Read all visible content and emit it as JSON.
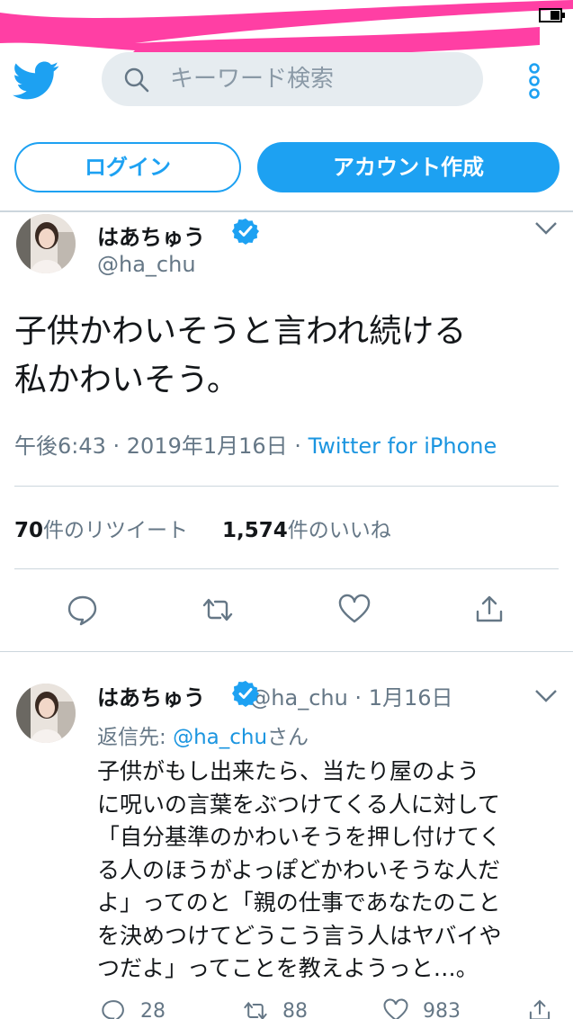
{
  "colors": {
    "accent": "#1da1f2",
    "link": "#1b95e0",
    "muted": "#657786",
    "scribble": "#ff3fa4"
  },
  "header": {
    "logo_icon": "twitter-bird-icon",
    "search": {
      "placeholder": "キーワード検索",
      "icon": "search-icon"
    },
    "more_icon": "more-vertical-icon"
  },
  "auth": {
    "login_label": "ログイン",
    "signup_label": "アカウント作成"
  },
  "tweet": {
    "name": "はあちゅう",
    "handle": "@ha_chu",
    "line1": "子供かわいそうと言われ続ける",
    "line2": "私かわいそう。",
    "time": "午後6:43 · 2019年1月16日 · ",
    "source": "Twitter for iPhone",
    "retweets_count": "70",
    "retweets_label": "件のリツイート",
    "likes_count": "1,574",
    "likes_label": "件のいいね"
  },
  "reply": {
    "name": "はあちゅう",
    "handle_date": " @ha_chu · 1月16日",
    "reply_prefix": "返信先: ",
    "reply_handle": "@ha_chu",
    "reply_suffix": "さん",
    "lines": [
      "子供がもし出来たら、当たり屋のよう",
      "に呪いの言葉をぶつけてくる人に対して",
      "「自分基準のかわいそうを押し付けてく",
      "る人のほうがよっぽどかわいそうな人だ",
      "よ」ってのと「親の仕事であなたのこと",
      "を決めつけてどうこう言う人はヤバイや",
      "つだよ」ってことを教えようっと…。"
    ],
    "reply_count": "28",
    "retweet_count": "88",
    "like_count": "983"
  }
}
